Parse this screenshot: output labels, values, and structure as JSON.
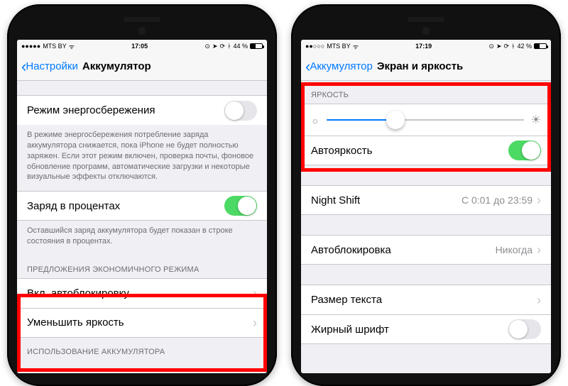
{
  "left": {
    "status": {
      "carrier": "MTS BY",
      "time": "17:05",
      "battery_pct": "44 %",
      "batt_fill": 44
    },
    "nav": {
      "back": "Настройки",
      "title": "Аккумулятор"
    },
    "lowpower": {
      "label": "Режим энергосбережения",
      "on": false,
      "desc": "В режиме энергосбережения потребление заряда аккумулятора снижается, пока iPhone не будет полностью заряжен. Если этот режим включен, проверка почты, фоновое обновление программ, автоматические загрузки и некоторые визуальные эффекты отключаются."
    },
    "percent": {
      "label": "Заряд в процентах",
      "on": true,
      "desc": "Оставшийся заряд аккумулятора будет показан в строке состояния в процентах."
    },
    "sugg": {
      "header": "ПРЕДЛОЖЕНИЯ ЭКОНОМИЧНОГО РЕЖИМА",
      "item1": "Вкл. автоблокировку",
      "item2": "Уменьшить яркость"
    },
    "usage_header": "ИСПОЛЬЗОВАНИЕ АККУМУЛЯТОРА"
  },
  "right": {
    "status": {
      "carrier": "MTS BY",
      "time": "17:19",
      "battery_pct": "42 %",
      "batt_fill": 42
    },
    "nav": {
      "back": "Аккумулятор",
      "title": "Экран и яркость"
    },
    "brightness": {
      "header": "ЯРКОСТЬ",
      "slider_pct": 35,
      "auto_label": "Автояркость",
      "auto_on": true
    },
    "nightshift": {
      "label": "Night Shift",
      "value": "С 0:01 до 23:59"
    },
    "autolock": {
      "label": "Автоблокировка",
      "value": "Никогда"
    },
    "textsize": {
      "label": "Размер текста"
    },
    "bold": {
      "label": "Жирный шрифт",
      "on": false
    }
  }
}
